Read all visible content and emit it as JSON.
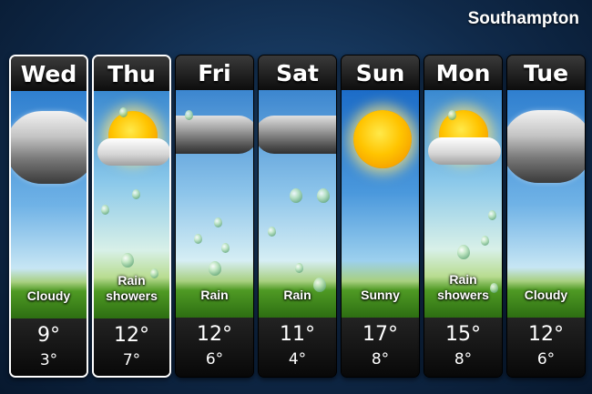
{
  "location": "Southampton",
  "forecast": [
    {
      "day": "Wed",
      "condition": "Cloudy",
      "high": "9°",
      "low": "3°",
      "icon": "cloudy-icon",
      "selected": true
    },
    {
      "day": "Thu",
      "condition": "Rain showers",
      "high": "12°",
      "low": "7°",
      "icon": "rain-showers-icon",
      "selected": true
    },
    {
      "day": "Fri",
      "condition": "Rain",
      "high": "12°",
      "low": "6°",
      "icon": "rain-icon",
      "selected": false
    },
    {
      "day": "Sat",
      "condition": "Rain",
      "high": "11°",
      "low": "4°",
      "icon": "rain-icon",
      "selected": false
    },
    {
      "day": "Sun",
      "condition": "Sunny",
      "high": "17°",
      "low": "8°",
      "icon": "sunny-icon",
      "selected": false
    },
    {
      "day": "Mon",
      "condition": "Rain showers",
      "high": "15°",
      "low": "8°",
      "icon": "rain-showers-icon",
      "selected": false
    },
    {
      "day": "Tue",
      "condition": "Cloudy",
      "high": "12°",
      "low": "6°",
      "icon": "cloudy-icon",
      "selected": false
    }
  ]
}
